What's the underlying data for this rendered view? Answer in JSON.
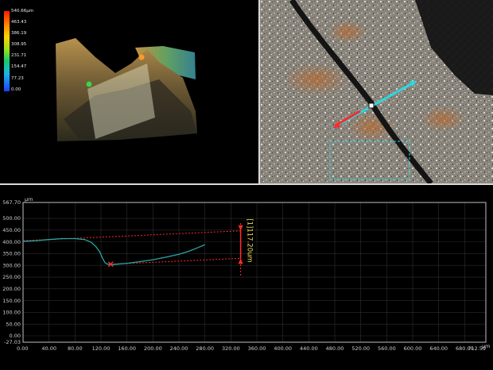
{
  "height_scale": {
    "labels": [
      "540.66µm",
      "463.43",
      "386.19",
      "308.95",
      "231.71",
      "154.47",
      "77.23",
      "0.00"
    ],
    "colors": [
      "#ff1a00",
      "#1f3dff"
    ]
  },
  "micrograph": {
    "measure_labels": [
      "",
      ""
    ],
    "line_color": "#2ad8e0",
    "measure_color": "#ff2a2a"
  },
  "profile": {
    "unit": "µm",
    "y_ticks": [
      "567.70",
      "500.00",
      "450.00",
      "400.00",
      "350.00",
      "300.00",
      "250.00",
      "200.00",
      "150.00",
      "100.00",
      "50.00",
      "0.00",
      "-27.03"
    ],
    "x_ticks": [
      "0.00",
      "40.00",
      "80.00",
      "120.00",
      "160.00",
      "200.00",
      "240.00",
      "280.00",
      "320.00",
      "360.00",
      "400.00",
      "440.00",
      "480.00",
      "520.00",
      "560.00",
      "600.00",
      "640.00",
      "680.00",
      "712.59"
    ],
    "measurement_label": "[1]117.20um",
    "measurement_value": 117.2,
    "profile_color": "#2aa6a6",
    "marker_color": "#ff2a2a"
  },
  "chart_data": {
    "type": "line",
    "xlabel": "",
    "ylabel": "µm",
    "xlim": [
      0,
      712.59
    ],
    "ylim": [
      -27.03,
      567.7
    ],
    "series": [
      {
        "x": [
          0,
          20,
          40,
          60,
          80,
          95,
          105,
          112,
          118,
          122,
          126,
          130,
          136,
          145,
          160,
          180,
          200,
          220,
          240,
          255,
          268,
          280
        ],
        "y": [
          402,
          405,
          410,
          414,
          414,
          410,
          398,
          380,
          358,
          333,
          312,
          305,
          303,
          305,
          309,
          316,
          324,
          335,
          347,
          360,
          374,
          388
        ]
      }
    ],
    "measurement": {
      "x1": 335,
      "y1": 447,
      "x2": 335,
      "y2": 330,
      "value": 117.2
    }
  }
}
